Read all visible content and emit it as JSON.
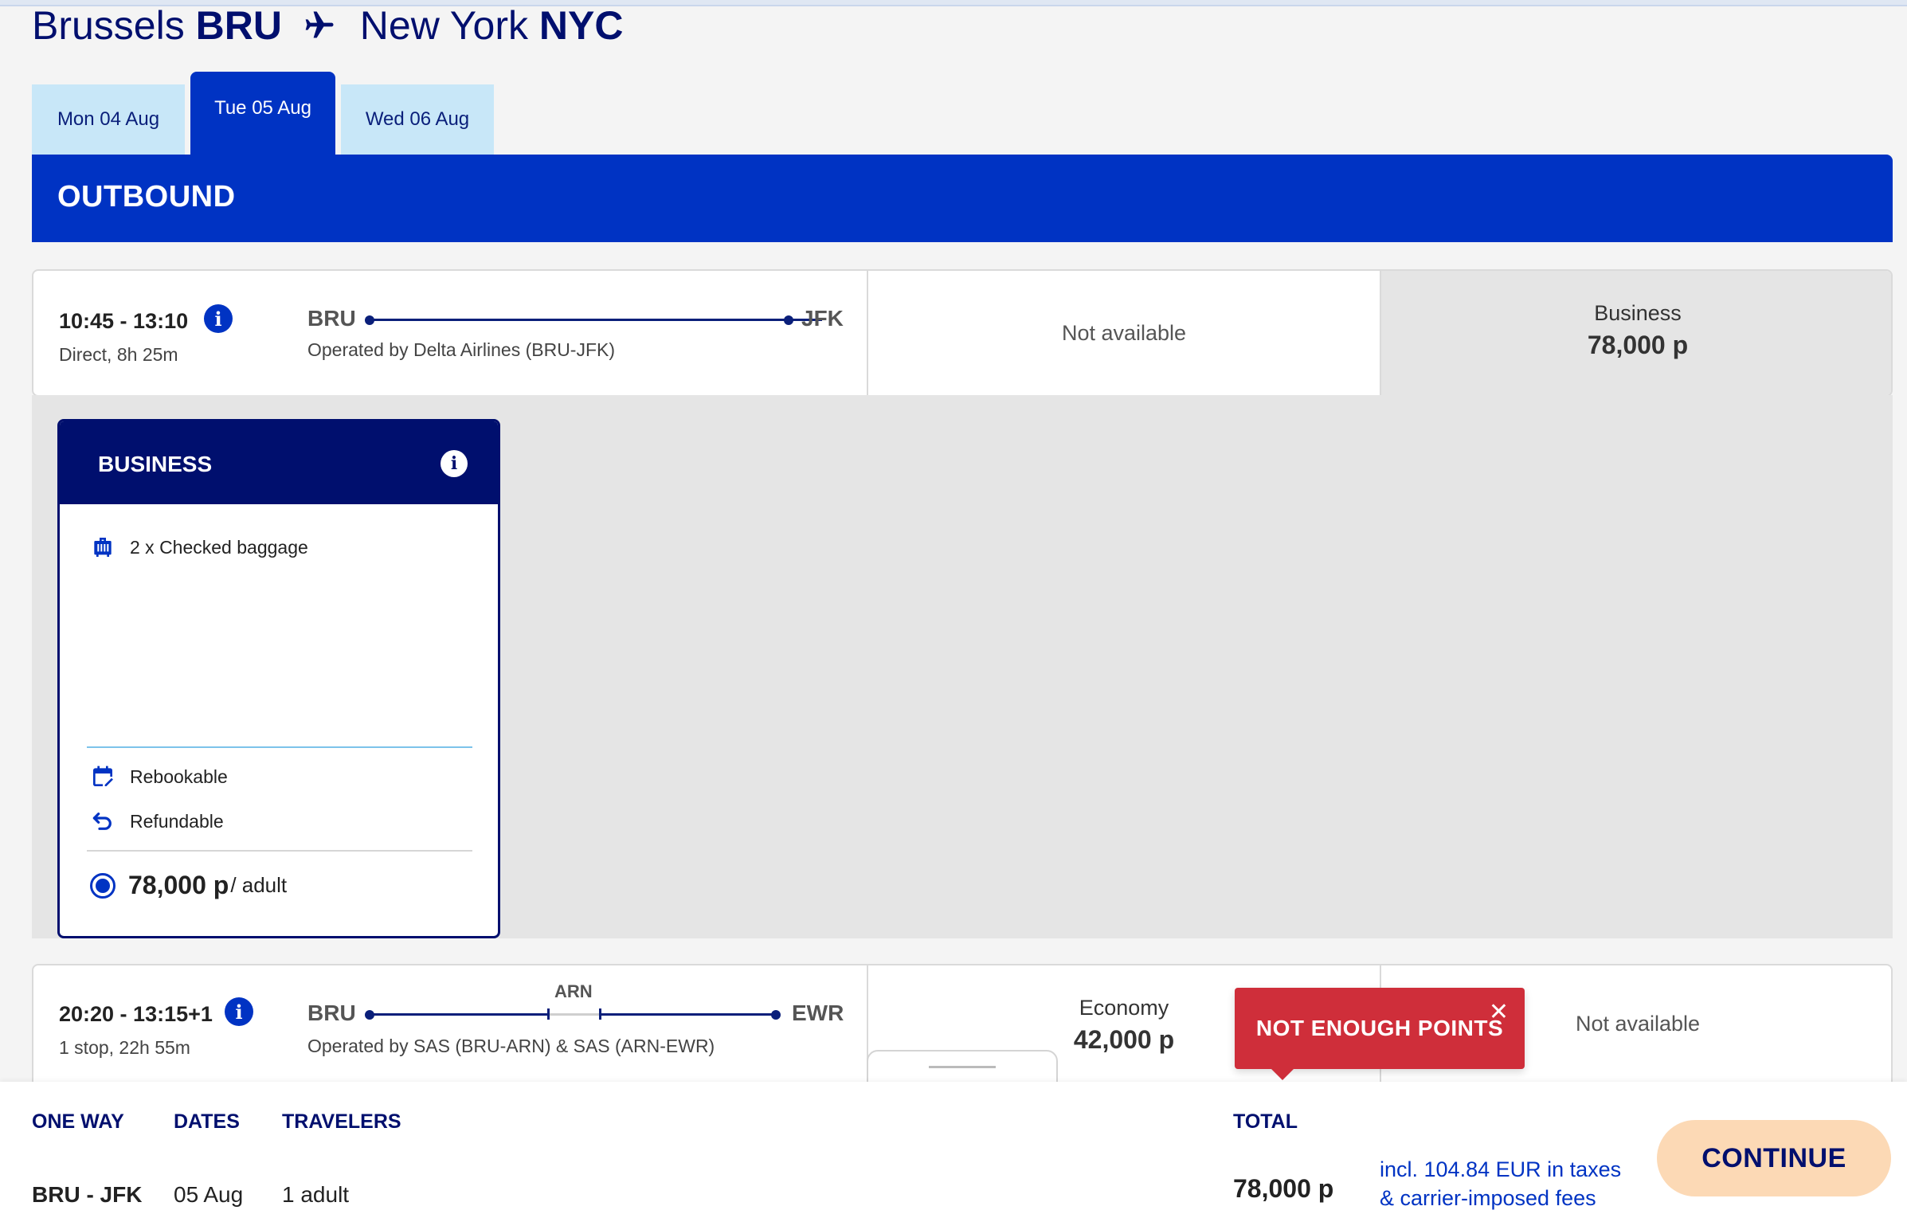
{
  "colors": {
    "brand_navy": "#000f6e",
    "brand_blue": "#0033c3",
    "tab_light": "#c8e7f8",
    "alert_red": "#cf2e3a",
    "continue_bg": "#fcd9b5"
  },
  "header": {
    "origin_city": "Brussels",
    "origin_code": "BRU",
    "destination_city": "New York",
    "destination_code": "NYC",
    "plane_icon": "airplane-icon"
  },
  "date_tabs": [
    {
      "label": "Mon 04 Aug",
      "active": false
    },
    {
      "label": "Tue 05 Aug",
      "active": true
    },
    {
      "label": "Wed 06 Aug",
      "active": false
    }
  ],
  "section_title": "OUTBOUND",
  "flights": [
    {
      "times": "10:45 - 13:10",
      "summary": "Direct, 8h 25m",
      "from": "BRU",
      "to": "JFK",
      "operated_by": "Operated by Delta Airlines (BRU-JFK)",
      "fares": [
        {
          "status": "Not available"
        },
        {
          "class": "Business",
          "points": "78,000 p"
        }
      ]
    },
    {
      "times": "20:20 - 13:15+1",
      "summary": "1 stop, 22h 55m",
      "from": "BRU",
      "stop": "ARN",
      "to": "EWR",
      "operated_by": "Operated by SAS (BRU-ARN) & SAS (ARN-EWR)",
      "fares": [
        {
          "class": "Economy",
          "points": "42,000 p"
        },
        {
          "status": "Not available"
        }
      ]
    }
  ],
  "fare_details": {
    "title": "BUSINESS",
    "features": [
      {
        "icon": "luggage-icon",
        "label": "2 x Checked baggage"
      }
    ],
    "flexibility": [
      {
        "icon": "calendar-edit-icon",
        "label": "Rebookable"
      },
      {
        "icon": "refund-arrow-icon",
        "label": "Refundable"
      }
    ],
    "price": "78,000 p",
    "price_suffix": "/ adult"
  },
  "alert": {
    "message": "NOT ENOUGH POINTS",
    "close_glyph": "✕"
  },
  "footer": {
    "trip_type_label": "ONE WAY",
    "dates_label": "DATES",
    "travelers_label": "TRAVELERS",
    "total_label": "TOTAL",
    "route": "BRU - JFK",
    "date": "05 Aug",
    "travelers": "1 adult",
    "total": "78,000 p",
    "taxes_line1": "incl. 104.84 EUR in taxes",
    "taxes_line2": "& carrier-imposed fees",
    "continue_label": "CONTINUE"
  }
}
